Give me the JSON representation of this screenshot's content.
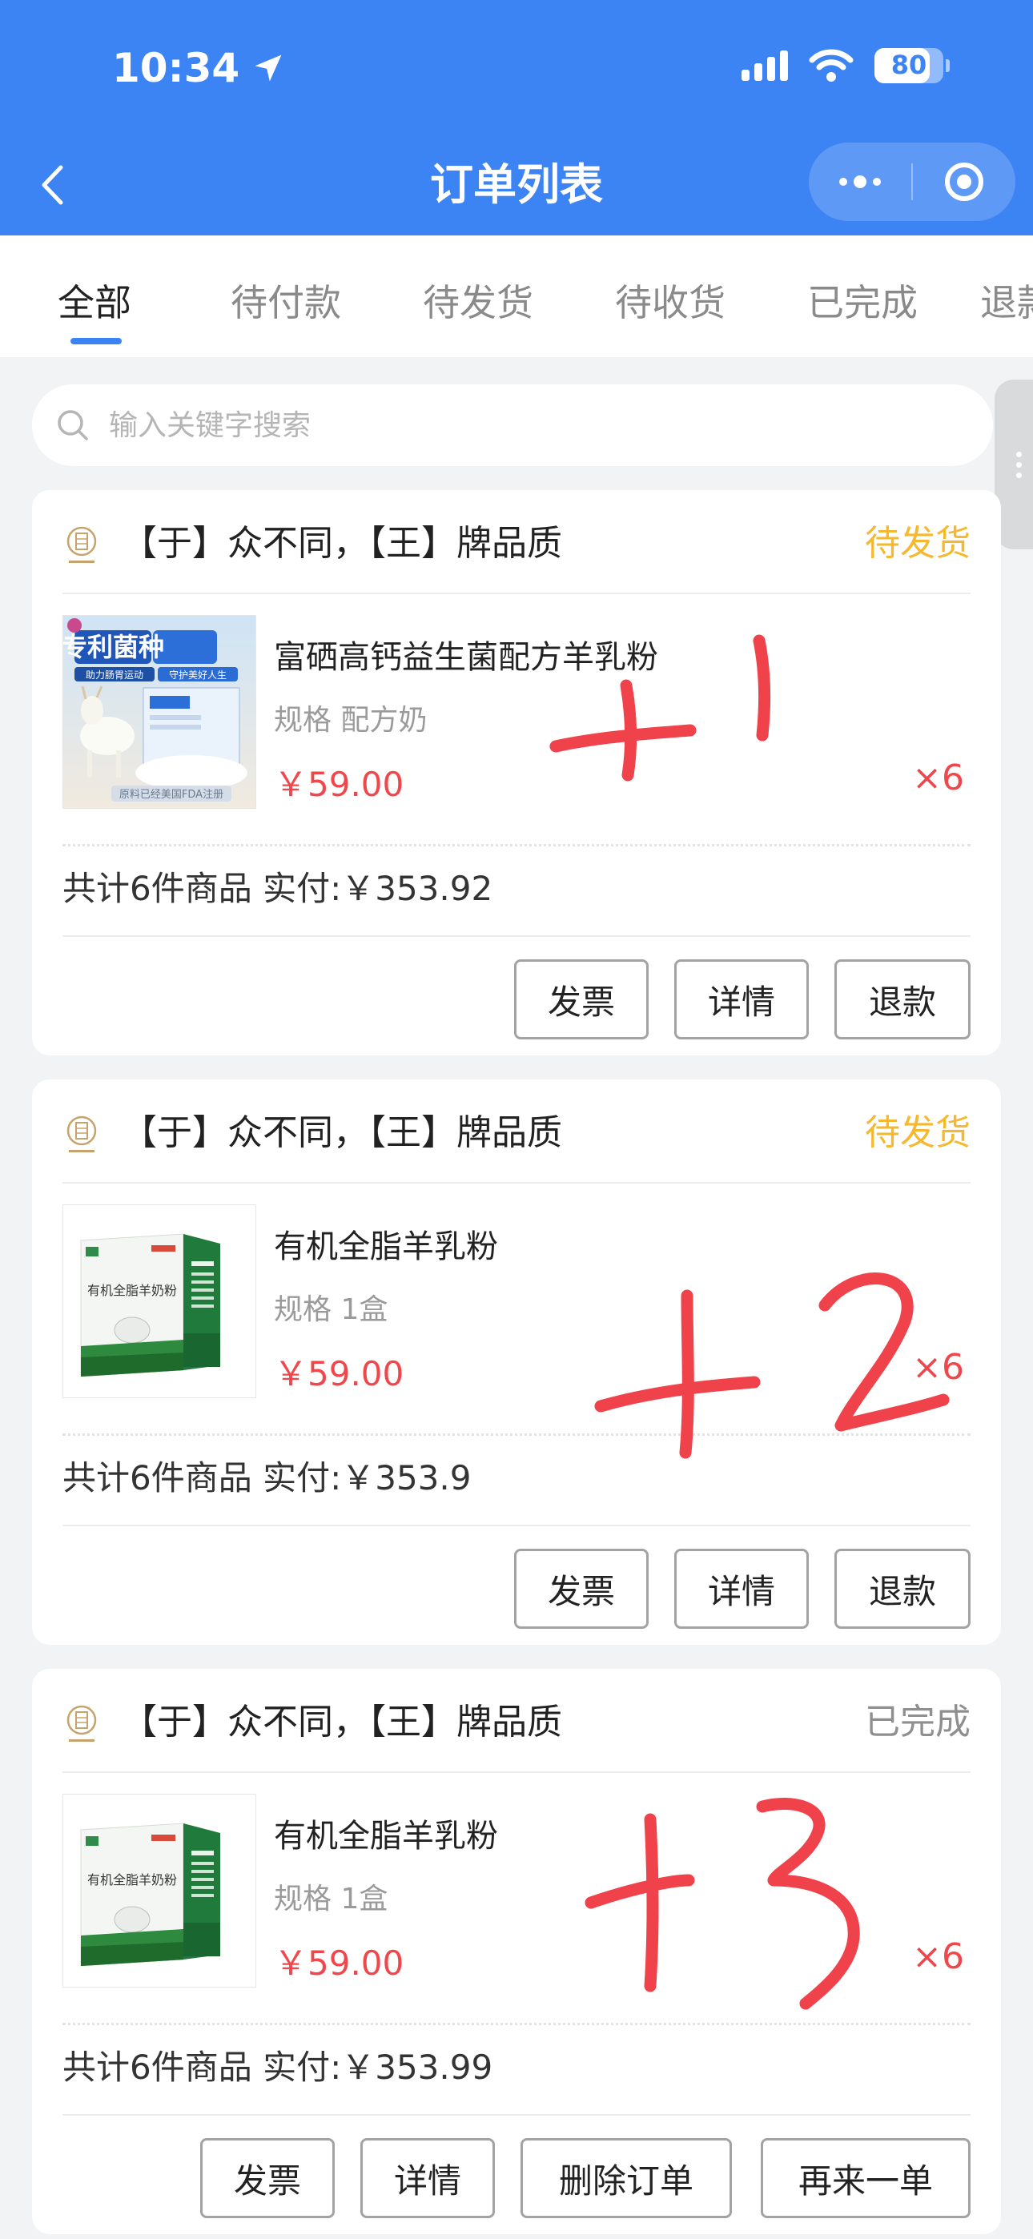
{
  "status_bar": {
    "time": "10:34",
    "battery": "80",
    "battery_level": 0.8
  },
  "nav": {
    "title": "订单列表"
  },
  "tabs": [
    {
      "label": "全部",
      "active": true
    },
    {
      "label": "待付款",
      "active": false
    },
    {
      "label": "待发货",
      "active": false
    },
    {
      "label": "待收货",
      "active": false
    },
    {
      "label": "已完成",
      "active": false
    },
    {
      "label": "退款",
      "active": false
    }
  ],
  "search": {
    "placeholder": "输入关键字搜索"
  },
  "colors": {
    "brand_blue": "#3c83f4",
    "status_pending": "#f5b82e",
    "status_done": "#8f8f8f",
    "price_red": "#f0474d",
    "annotation_red": "#f0424a"
  },
  "orders": [
    {
      "shop_name": "【于】众不同，【王】牌品质",
      "status": "待发货",
      "status_color": "#f5b82e",
      "product_name": "富硒高钙益生菌配方羊乳粉",
      "spec": "规格 配方奶",
      "price": "￥59.00",
      "qty": "×6",
      "summary": "共计6件商品 实付:￥353.92",
      "buttons": [
        "发票",
        "详情",
        "退款"
      ],
      "annotation": "+1",
      "thumb_text": {
        "title": "专利菌种",
        "sub1": "助力肠胃运动",
        "sub2": "守护美好人生",
        "bottom": "原料已经美国FDA注册"
      }
    },
    {
      "shop_name": "【于】众不同，【王】牌品质",
      "status": "待发货",
      "status_color": "#f5b82e",
      "product_name": "有机全脂羊乳粉",
      "spec": "规格 1盒",
      "price": "￥59.00",
      "qty": "×6",
      "summary": "共计6件商品 实付:￥353.9",
      "buttons": [
        "发票",
        "详情",
        "退款"
      ],
      "annotation": "+2",
      "thumb_text": {
        "title": "有机全脂羊奶粉"
      }
    },
    {
      "shop_name": "【于】众不同，【王】牌品质",
      "status": "已完成",
      "status_color": "#8f8f8f",
      "product_name": "有机全脂羊乳粉",
      "spec": "规格 1盒",
      "price": "￥59.00",
      "qty": "×6",
      "summary": "共计6件商品 实付:￥353.99",
      "buttons": [
        "发票",
        "详情",
        "删除订单",
        "再来一单"
      ],
      "annotation": "+3",
      "thumb_text": {
        "title": "有机全脂羊奶粉"
      }
    }
  ]
}
